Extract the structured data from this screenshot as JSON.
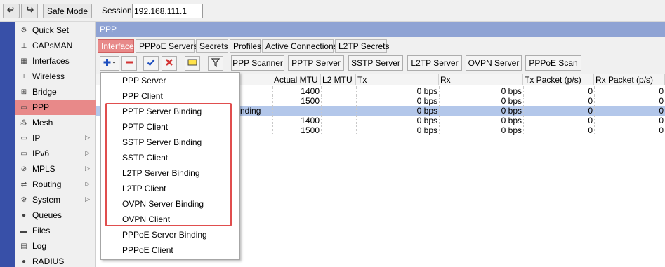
{
  "toolbar": {
    "undo_icon": "undo-icon",
    "redo_icon": "redo-icon",
    "safe_mode_label": "Safe Mode",
    "session_label": "Session:",
    "session_value": "192.168.111.1"
  },
  "sidebar": {
    "items": [
      {
        "label": "Quick Set",
        "icon": "quick-set-icon"
      },
      {
        "label": "CAPsMAN",
        "icon": "capsman-icon"
      },
      {
        "label": "Interfaces",
        "icon": "interfaces-icon"
      },
      {
        "label": "Wireless",
        "icon": "wireless-icon"
      },
      {
        "label": "Bridge",
        "icon": "bridge-icon"
      },
      {
        "label": "PPP",
        "icon": "ppp-icon"
      },
      {
        "label": "Mesh",
        "icon": "mesh-icon"
      },
      {
        "label": "IP",
        "icon": "ip-icon"
      },
      {
        "label": "IPv6",
        "icon": "ipv6-icon"
      },
      {
        "label": "MPLS",
        "icon": "mpls-icon"
      },
      {
        "label": "Routing",
        "icon": "routing-icon"
      },
      {
        "label": "System",
        "icon": "system-icon"
      },
      {
        "label": "Queues",
        "icon": "queues-icon"
      },
      {
        "label": "Files",
        "icon": "files-icon"
      },
      {
        "label": "Log",
        "icon": "log-icon"
      },
      {
        "label": "RADIUS",
        "icon": "radius-icon"
      }
    ],
    "active": "PPP"
  },
  "window": {
    "title": "PPP",
    "tabs": [
      "Interface",
      "PPPoE Servers",
      "Secrets",
      "Profiles",
      "Active Connections",
      "L2TP Secrets"
    ],
    "active_tab": "Interface",
    "buttons": [
      "PPP Scanner",
      "PPTP Server",
      "SSTP Server",
      "L2TP Server",
      "OVPN Server",
      "PPPoE Scan"
    ]
  },
  "table": {
    "columns": [
      "Actual MTU",
      "L2 MTU",
      "Tx",
      "Rx",
      "Tx Packet (p/s)",
      "Rx Packet (p/s)"
    ],
    "rows": [
      {
        "name": "",
        "actual_mtu": "1400",
        "l2_mtu": "",
        "tx": "0 bps",
        "rx": "0 bps",
        "tx_pps": "0",
        "rx_pps": "0"
      },
      {
        "name": "",
        "actual_mtu": "1500",
        "l2_mtu": "",
        "tx": "0 bps",
        "rx": "0 bps",
        "tx_pps": "0",
        "rx_pps": "0"
      },
      {
        "name": "nding",
        "actual_mtu": "",
        "l2_mtu": "",
        "tx": "0 bps",
        "rx": "0 bps",
        "tx_pps": "0",
        "rx_pps": "0"
      },
      {
        "name": "",
        "actual_mtu": "1400",
        "l2_mtu": "",
        "tx": "0 bps",
        "rx": "0 bps",
        "tx_pps": "0",
        "rx_pps": "0"
      },
      {
        "name": "",
        "actual_mtu": "1500",
        "l2_mtu": "",
        "tx": "0 bps",
        "rx": "0 bps",
        "tx_pps": "0",
        "rx_pps": "0"
      }
    ],
    "selected_row": 2
  },
  "add_menu": {
    "items": [
      "PPP Server",
      "PPP Client",
      "PPTP Server Binding",
      "PPTP Client",
      "SSTP Server Binding",
      "SSTP Client",
      "L2TP Server Binding",
      "L2TP Client",
      "OVPN Server Binding",
      "OVPN Client",
      "PPPoE Server Binding",
      "PPPoE Client"
    ],
    "highlighted": [
      "PPTP Server Binding",
      "PPTP Client",
      "SSTP Server Binding",
      "SSTP Client",
      "L2TP Server Binding",
      "L2TP Client",
      "OVPN Server Binding",
      "OVPN Client"
    ]
  },
  "colors": {
    "accent_pink": "#e88989",
    "title_blue": "#8fa3d4",
    "stripe_blue": "#3850a8",
    "selection_blue": "#b3c7ea",
    "highlight_red": "#e04e4e",
    "add_blue": "#1f4fbf",
    "remove_red": "#d33333"
  }
}
